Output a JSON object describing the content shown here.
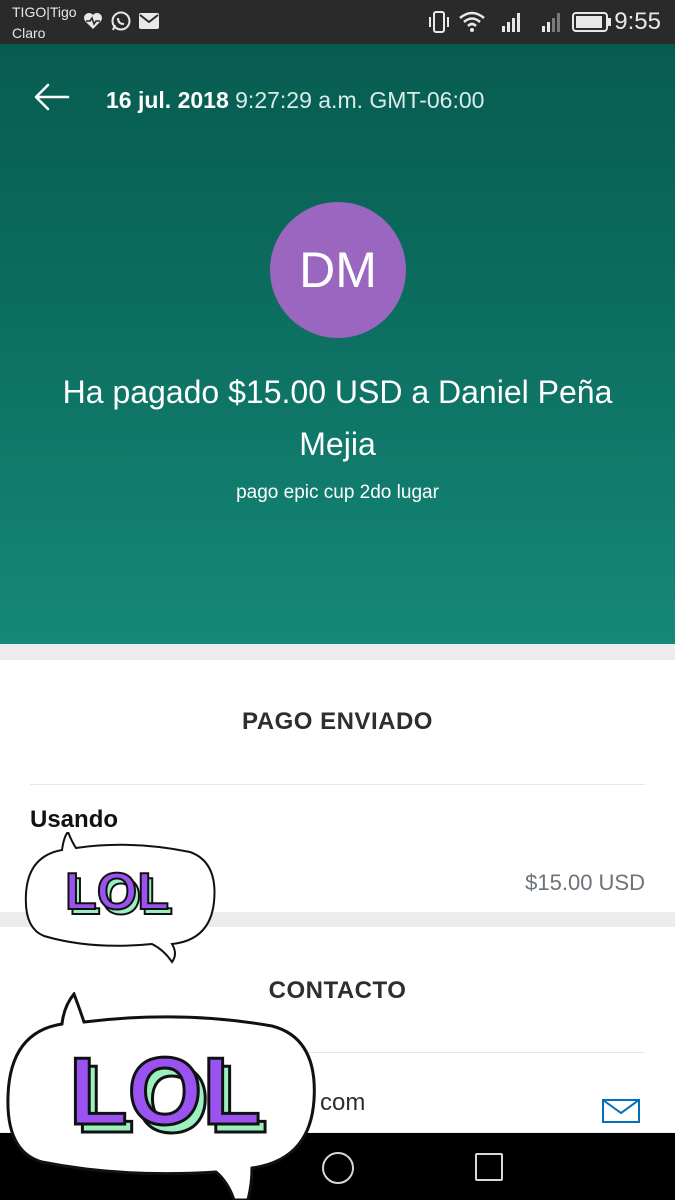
{
  "status_bar": {
    "carrier_primary": "TIGO|Tigo",
    "carrier_secondary": "Claro",
    "time": "9:55"
  },
  "header": {
    "date": "16 jul. 2018",
    "time": "9:27:29 a.m. GMT-06:00",
    "avatar_initials": "DM",
    "avatar_color": "#9b66c0",
    "headline": "Ha pagado $15.00 USD a Daniel Peña Mejia",
    "note": "pago epic cup 2do lugar"
  },
  "payment_card": {
    "title": "PAGO ENVIADO",
    "using_label": "Usando",
    "amount": "$15.00 USD"
  },
  "contact_card": {
    "title": "CONTACTO",
    "email_partial": "com"
  },
  "stickers": {
    "text": "LOL"
  },
  "colors": {
    "header_top": "#075c50",
    "header_bottom": "#158879",
    "accent_link": "#0070ba"
  }
}
